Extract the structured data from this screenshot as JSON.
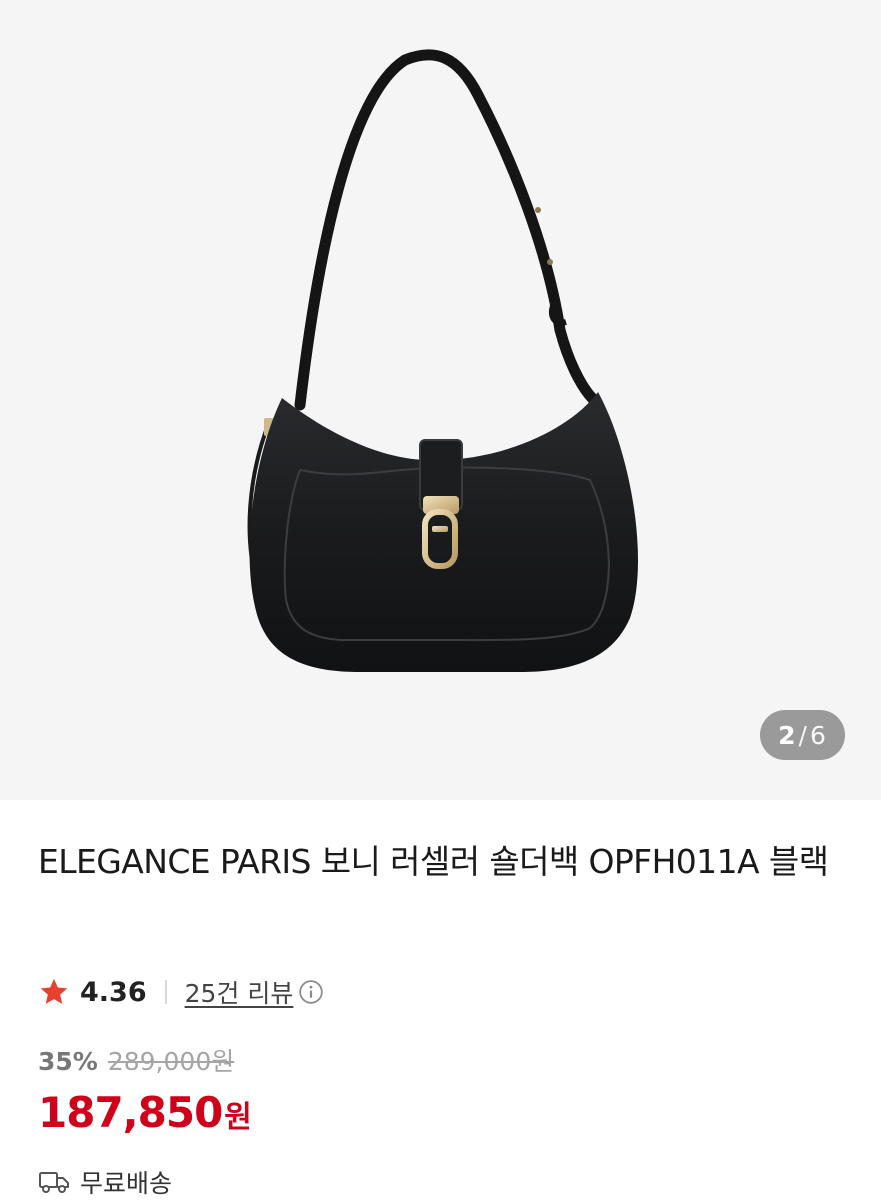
{
  "gallery": {
    "current": "2",
    "separator": "/",
    "total": "6",
    "image": "black-leather-shoulder-bag-photo"
  },
  "product": {
    "title": "ELEGANCE PARIS 보니 러셀러 숄더백 OPFH011A 블랙",
    "rating": "4.36",
    "review_link": "25건 리뷰",
    "discount": "35%",
    "original_price": "289,000원",
    "price": "187,850",
    "price_unit": "원",
    "shipping": "무료배송"
  },
  "icons": {
    "rating": "star-icon",
    "review_info": "info-icon",
    "shipping": "truck-icon"
  },
  "colors": {
    "accent": "#d0021b",
    "star": "#e8402f",
    "gallery_bg": "#f5f5f5",
    "pager_bg": "#9a9a9a"
  }
}
